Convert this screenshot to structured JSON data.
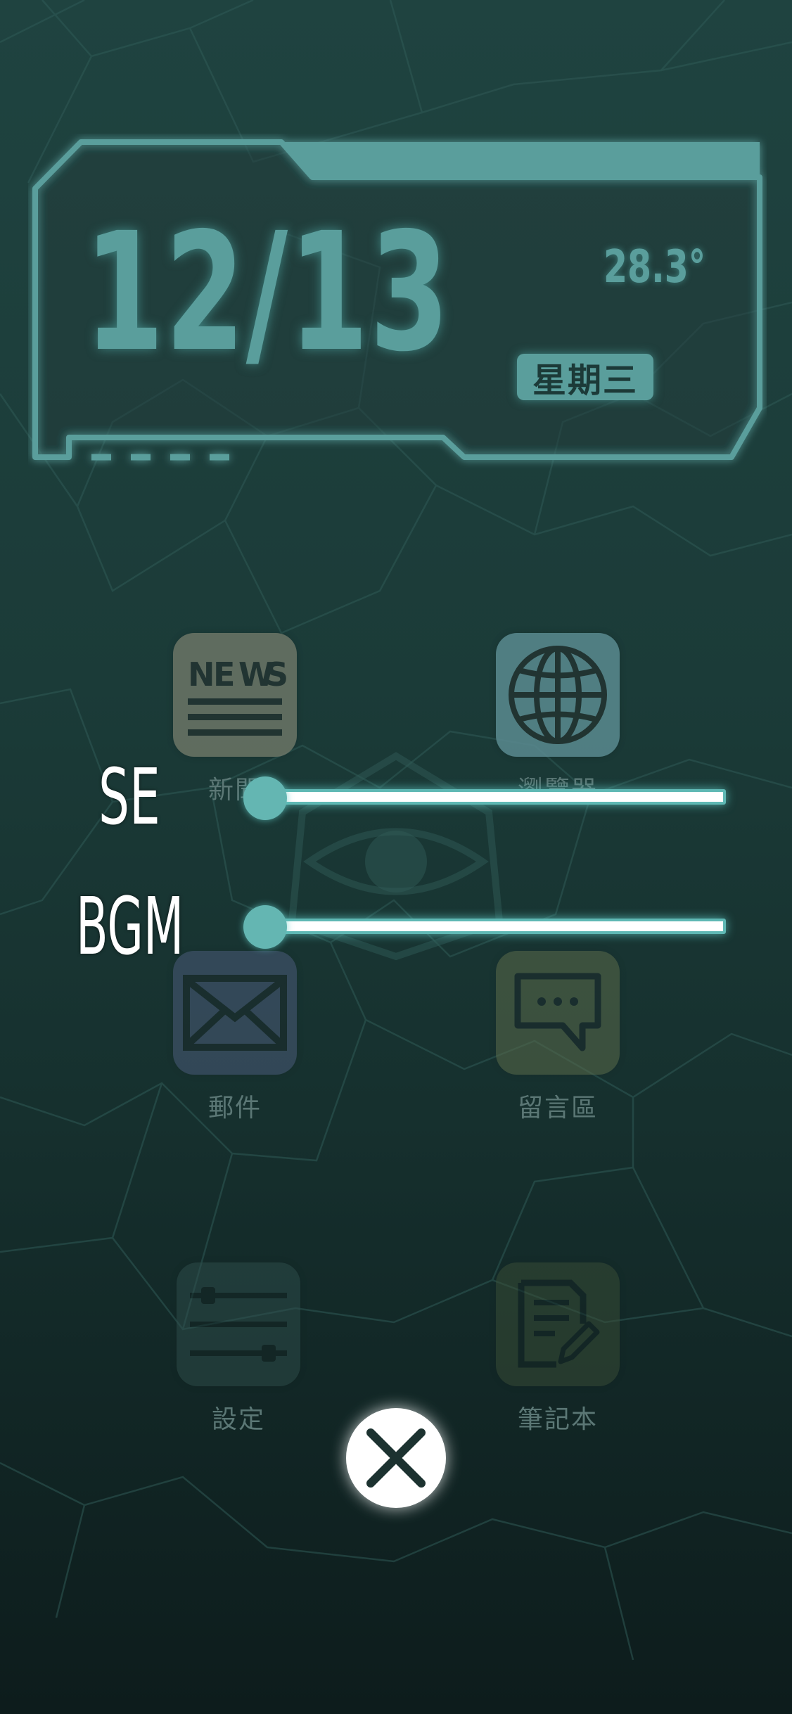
{
  "header": {
    "date": "12/13",
    "temperature": "28.3°",
    "weekday": "星期三"
  },
  "apps": [
    {
      "id": "news",
      "label": "新聞",
      "icon": "news-icon",
      "tile_color": "#6c7566",
      "tile_opacity": 0.85
    },
    {
      "id": "browser",
      "label": "瀏覽器",
      "icon": "globe-icon",
      "tile_color": "#5a8a90",
      "tile_opacity": 0.85
    },
    {
      "id": "mail",
      "label": "郵件",
      "icon": "mail-icon",
      "tile_color": "#4a5a78",
      "tile_opacity": 0.55
    },
    {
      "id": "board",
      "label": "留言區",
      "icon": "chat-bubble-icon",
      "tile_color": "#5a6a4a",
      "tile_opacity": 0.55
    },
    {
      "id": "settings",
      "label": "設定",
      "icon": "sliders-icon",
      "tile_color": "#2e4d4b",
      "tile_opacity": 0.5
    },
    {
      "id": "notebook",
      "label": "筆記本",
      "icon": "notebook-pen-icon",
      "tile_color": "#3a4e36",
      "tile_opacity": 0.5
    }
  ],
  "sound": {
    "se_label": "SE",
    "bgm_label": "BGM",
    "se_level": 0,
    "bgm_level": 0
  },
  "close_icon": "close-icon",
  "colors": {
    "accent": "#5a9e9c",
    "track_glow": "#5fb8b4",
    "knob": "#64b6b2",
    "background_top": "#1f4340",
    "background_bottom": "#0d1c1c"
  }
}
